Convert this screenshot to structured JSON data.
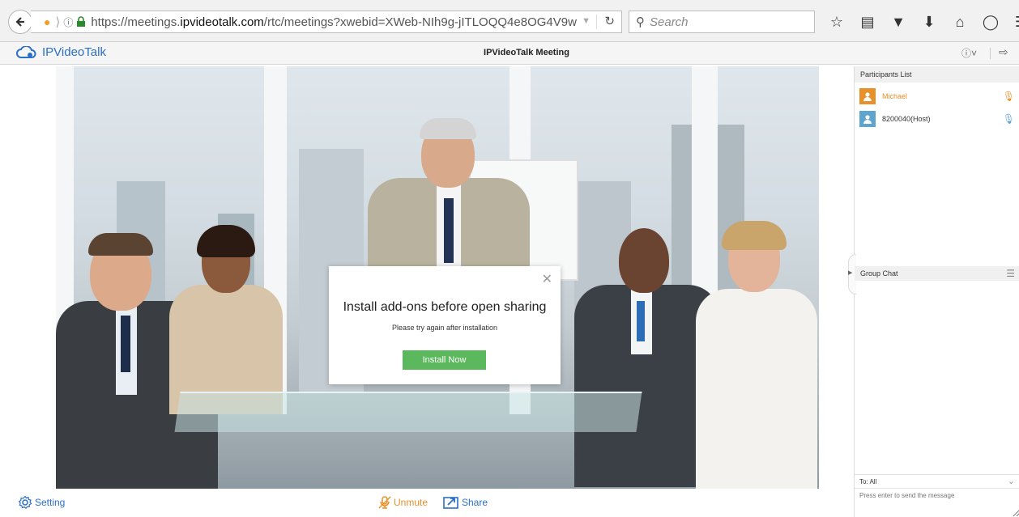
{
  "browser": {
    "url_prefix": "https://meetings.",
    "url_domain": "ipvideotalk.com",
    "url_path": "/rtc/meetings?xwebid=XWeb-NIh9g-jITLOQQ4e8OG4V9w",
    "search_placeholder": "Search"
  },
  "app": {
    "logo_text": "IPVideoTalk",
    "title": "IPVideoTalk Meeting"
  },
  "modal": {
    "title": "Install add-ons before open sharing",
    "subtitle": "Please try again after installation",
    "button_label": "Install Now"
  },
  "participants": {
    "header": "Participants List",
    "items": [
      {
        "name": "Michael",
        "color": "#e8902a"
      },
      {
        "name": "8200040(Host)",
        "color": "#333333"
      }
    ]
  },
  "chat": {
    "header": "Group Chat",
    "to_label": "To: All",
    "input_placeholder": "Press enter to send the message"
  },
  "controls": {
    "setting_label": "Setting",
    "unmute_label": "Unmute",
    "share_label": "Share"
  },
  "colors": {
    "brand_blue": "#2a6fc9",
    "accent_orange": "#e8902a",
    "install_green": "#5cb85c"
  }
}
